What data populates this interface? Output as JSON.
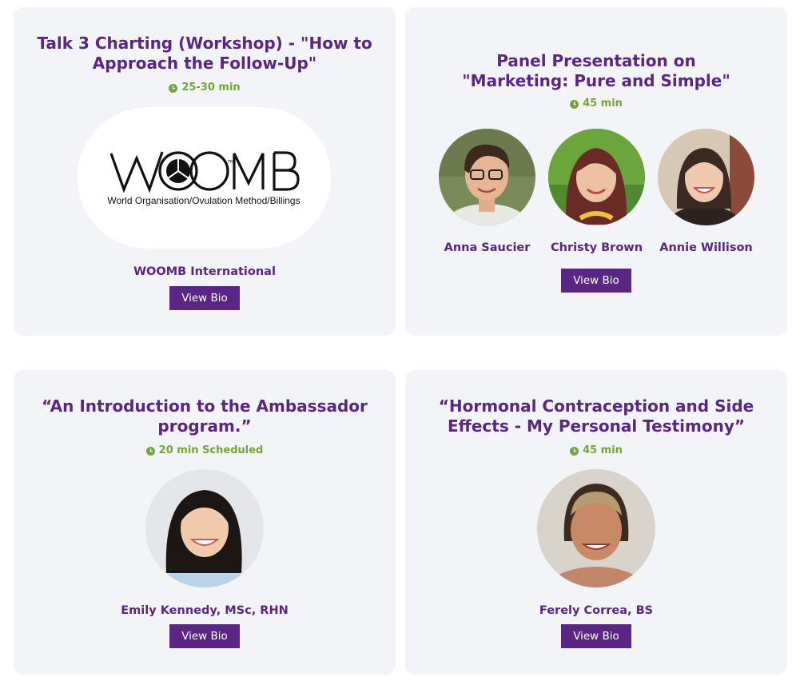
{
  "cards": [
    {
      "title": "Talk 3 Charting (Workshop) - \"How to Approach the Follow-Up\"",
      "duration": "25-30 min",
      "logo": {
        "brand": "WOOMB",
        "tm": "TM",
        "subtitle": "World Organisation/Ovulation Method/Billings"
      },
      "speakers": [
        "WOOMB International"
      ],
      "button_label": "View Bio"
    },
    {
      "title_line1": "Panel Presentation on",
      "title_line2": "\"Marketing: Pure and Simple\"",
      "duration": "45 min",
      "speakers": [
        "Anna Saucier",
        "Christy Brown",
        "Annie Willison"
      ],
      "button_label": "View Bio"
    },
    {
      "title": "“An Introduction to the Ambassador program.”",
      "duration": "20 min Scheduled",
      "speakers": [
        "Emily Kennedy, MSc, RHN"
      ],
      "button_label": "View Bio"
    },
    {
      "title": "“Hormonal Contraception and Side Effects - My Personal Testimony”",
      "duration": "45 min",
      "speakers": [
        "Ferely Correa, BS"
      ],
      "button_label": "View Bio"
    }
  ],
  "colors": {
    "accent": "#5a2583",
    "duration": "#76a437",
    "card_bg": "#f3f4f8"
  },
  "icons": [
    "clock-icon"
  ]
}
